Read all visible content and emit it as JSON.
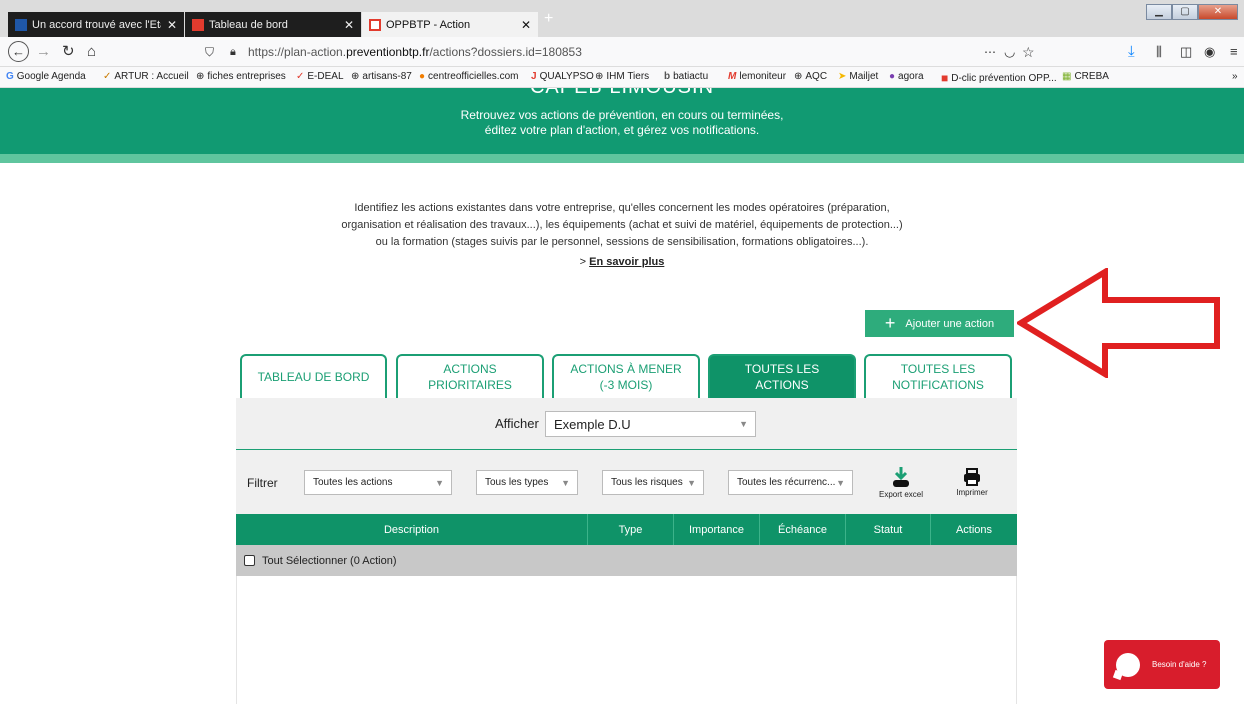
{
  "browser": {
    "tabs": [
      {
        "title": "Un accord trouvé avec l'Etat po",
        "fav_color": "#1f57a8"
      },
      {
        "title": "Tableau de bord",
        "fav_color": "#e23b2e"
      },
      {
        "title": "OPPBTP - Action",
        "fav_color": "#e23b2e"
      }
    ],
    "new_tab": "+",
    "url": "https://plan-action.preventionbtp.fr/actions?dossiers.id=180853",
    "url_prefix": "https://plan-action.",
    "url_domain": "preventionbtp.fr",
    "url_suffix": "/actions?dossiers.id=180853",
    "bookmarks": [
      {
        "label": "Google Agenda",
        "icon": "G"
      },
      {
        "label": "ARTUR : Accueil",
        "icon": "✓"
      },
      {
        "label": "fiches entreprises",
        "icon": "⊕"
      },
      {
        "label": "E-DEAL",
        "icon": "✓"
      },
      {
        "label": "artisans-87",
        "icon": "⊕"
      },
      {
        "label": "centreofficielles.com",
        "icon": "●"
      },
      {
        "label": "QUALYPSO",
        "icon": "J"
      },
      {
        "label": "IHM Tiers",
        "icon": "⊕"
      },
      {
        "label": "batiactu",
        "icon": "b"
      },
      {
        "label": "lemoniteur",
        "icon": "M"
      },
      {
        "label": "AQC",
        "icon": "⊕"
      },
      {
        "label": "Mailjet",
        "icon": "➤"
      },
      {
        "label": "agora",
        "icon": "●"
      },
      {
        "label": "D-clic prévention OPP...",
        "icon": "■"
      },
      {
        "label": "CREBA",
        "icon": "▦"
      }
    ]
  },
  "banner": {
    "title": "CAPEB LIMOUSIN",
    "line1": "Retrouvez vos actions de prévention, en cours ou terminées,",
    "line2": "éditez votre plan d'action, et gérez vos notifications."
  },
  "intro": {
    "line1": "Identifiez les actions existantes dans votre entreprise, qu'elles concernent les modes opératoires (préparation,",
    "line2": "organisation et réalisation des travaux...), les équipements (achat et suivi de matériel, équipements de protection...)",
    "line3": "ou la formation (stages suivis par le personnel, sessions de sensibilisation, formations obligatoires...).",
    "more_prefix": "> ",
    "more_link": "En savoir plus"
  },
  "add_action": {
    "label": "Ajouter une action"
  },
  "tabs": [
    {
      "line1": "TABLEAU DE BORD",
      "line2": ""
    },
    {
      "line1": "ACTIONS",
      "line2": "PRIORITAIRES"
    },
    {
      "line1": "ACTIONS À MENER",
      "line2": "(-3 MOIS)"
    },
    {
      "line1": "TOUTES LES",
      "line2": "ACTIONS"
    },
    {
      "line1": "TOUTES LES",
      "line2": "NOTIFICATIONS"
    }
  ],
  "afficher": {
    "label": "Afficher",
    "value": "Exemple D.U"
  },
  "filters": {
    "label": "Filtrer",
    "actions": "Toutes les actions",
    "types": "Tous les types",
    "risques": "Tous les risques",
    "recurrences": "Toutes les récurrenc...",
    "export": "Export excel",
    "print": "Imprimer"
  },
  "table": {
    "columns": [
      "Description",
      "Type",
      "Importance",
      "Échéance",
      "Statut",
      "Actions"
    ],
    "select_all": "Tout Sélectionner (0 Action)"
  },
  "help": {
    "label": "Besoin d'aide ?"
  },
  "colors": {
    "brand": "#119a72",
    "accent": "#2eac7c",
    "help": "#d81d2c",
    "annotation_arrow": "#e02020"
  }
}
